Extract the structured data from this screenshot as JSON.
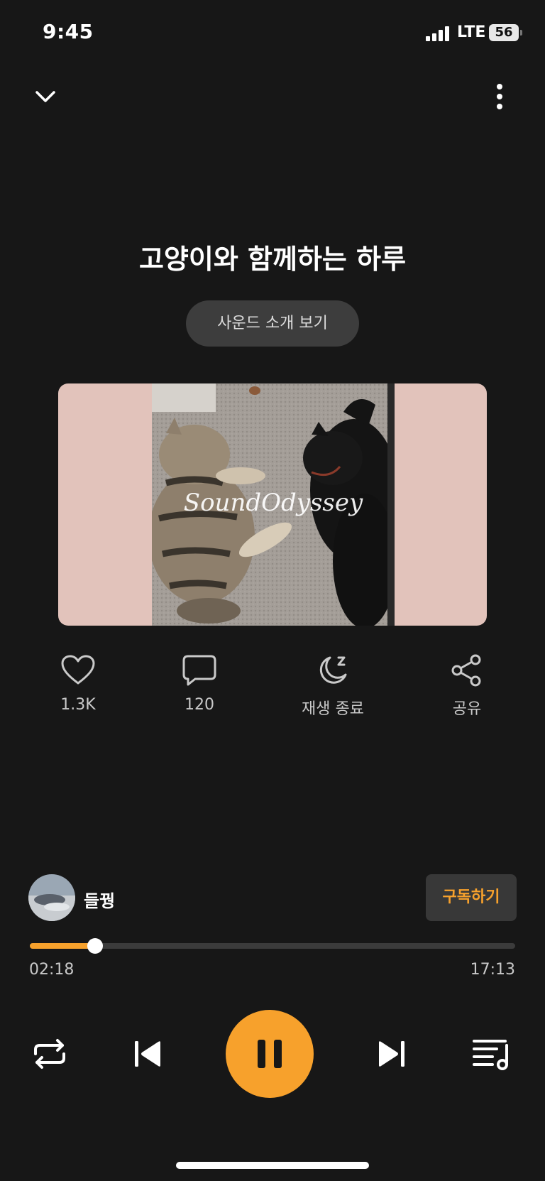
{
  "status_bar": {
    "time": "9:45",
    "network": "LTE",
    "battery": "56"
  },
  "track": {
    "title": "고양이와 함께하는 하루",
    "intro_button": "사운드 소개 보기",
    "artwork_watermark": "SoundOdyssey"
  },
  "actions": {
    "like_count": "1.3K",
    "comment_count": "120",
    "sleep_timer_label": "재생 종료",
    "share_label": "공유"
  },
  "creator": {
    "name": "들꿩",
    "subscribe_label": "구독하기"
  },
  "progress": {
    "elapsed": "02:18",
    "duration": "17:13",
    "fraction": 0.134
  },
  "colors": {
    "accent": "#f7a12c",
    "background": "#171717",
    "surface": "#3d3d3d",
    "artwork_bg": "#e2c3bb"
  },
  "icons": [
    "chevron-down-icon",
    "more-vertical-icon",
    "heart-icon",
    "comment-icon",
    "moon-sleep-icon",
    "share-icon",
    "repeat-icon",
    "skip-previous-icon",
    "pause-icon",
    "skip-next-icon",
    "playlist-icon"
  ]
}
